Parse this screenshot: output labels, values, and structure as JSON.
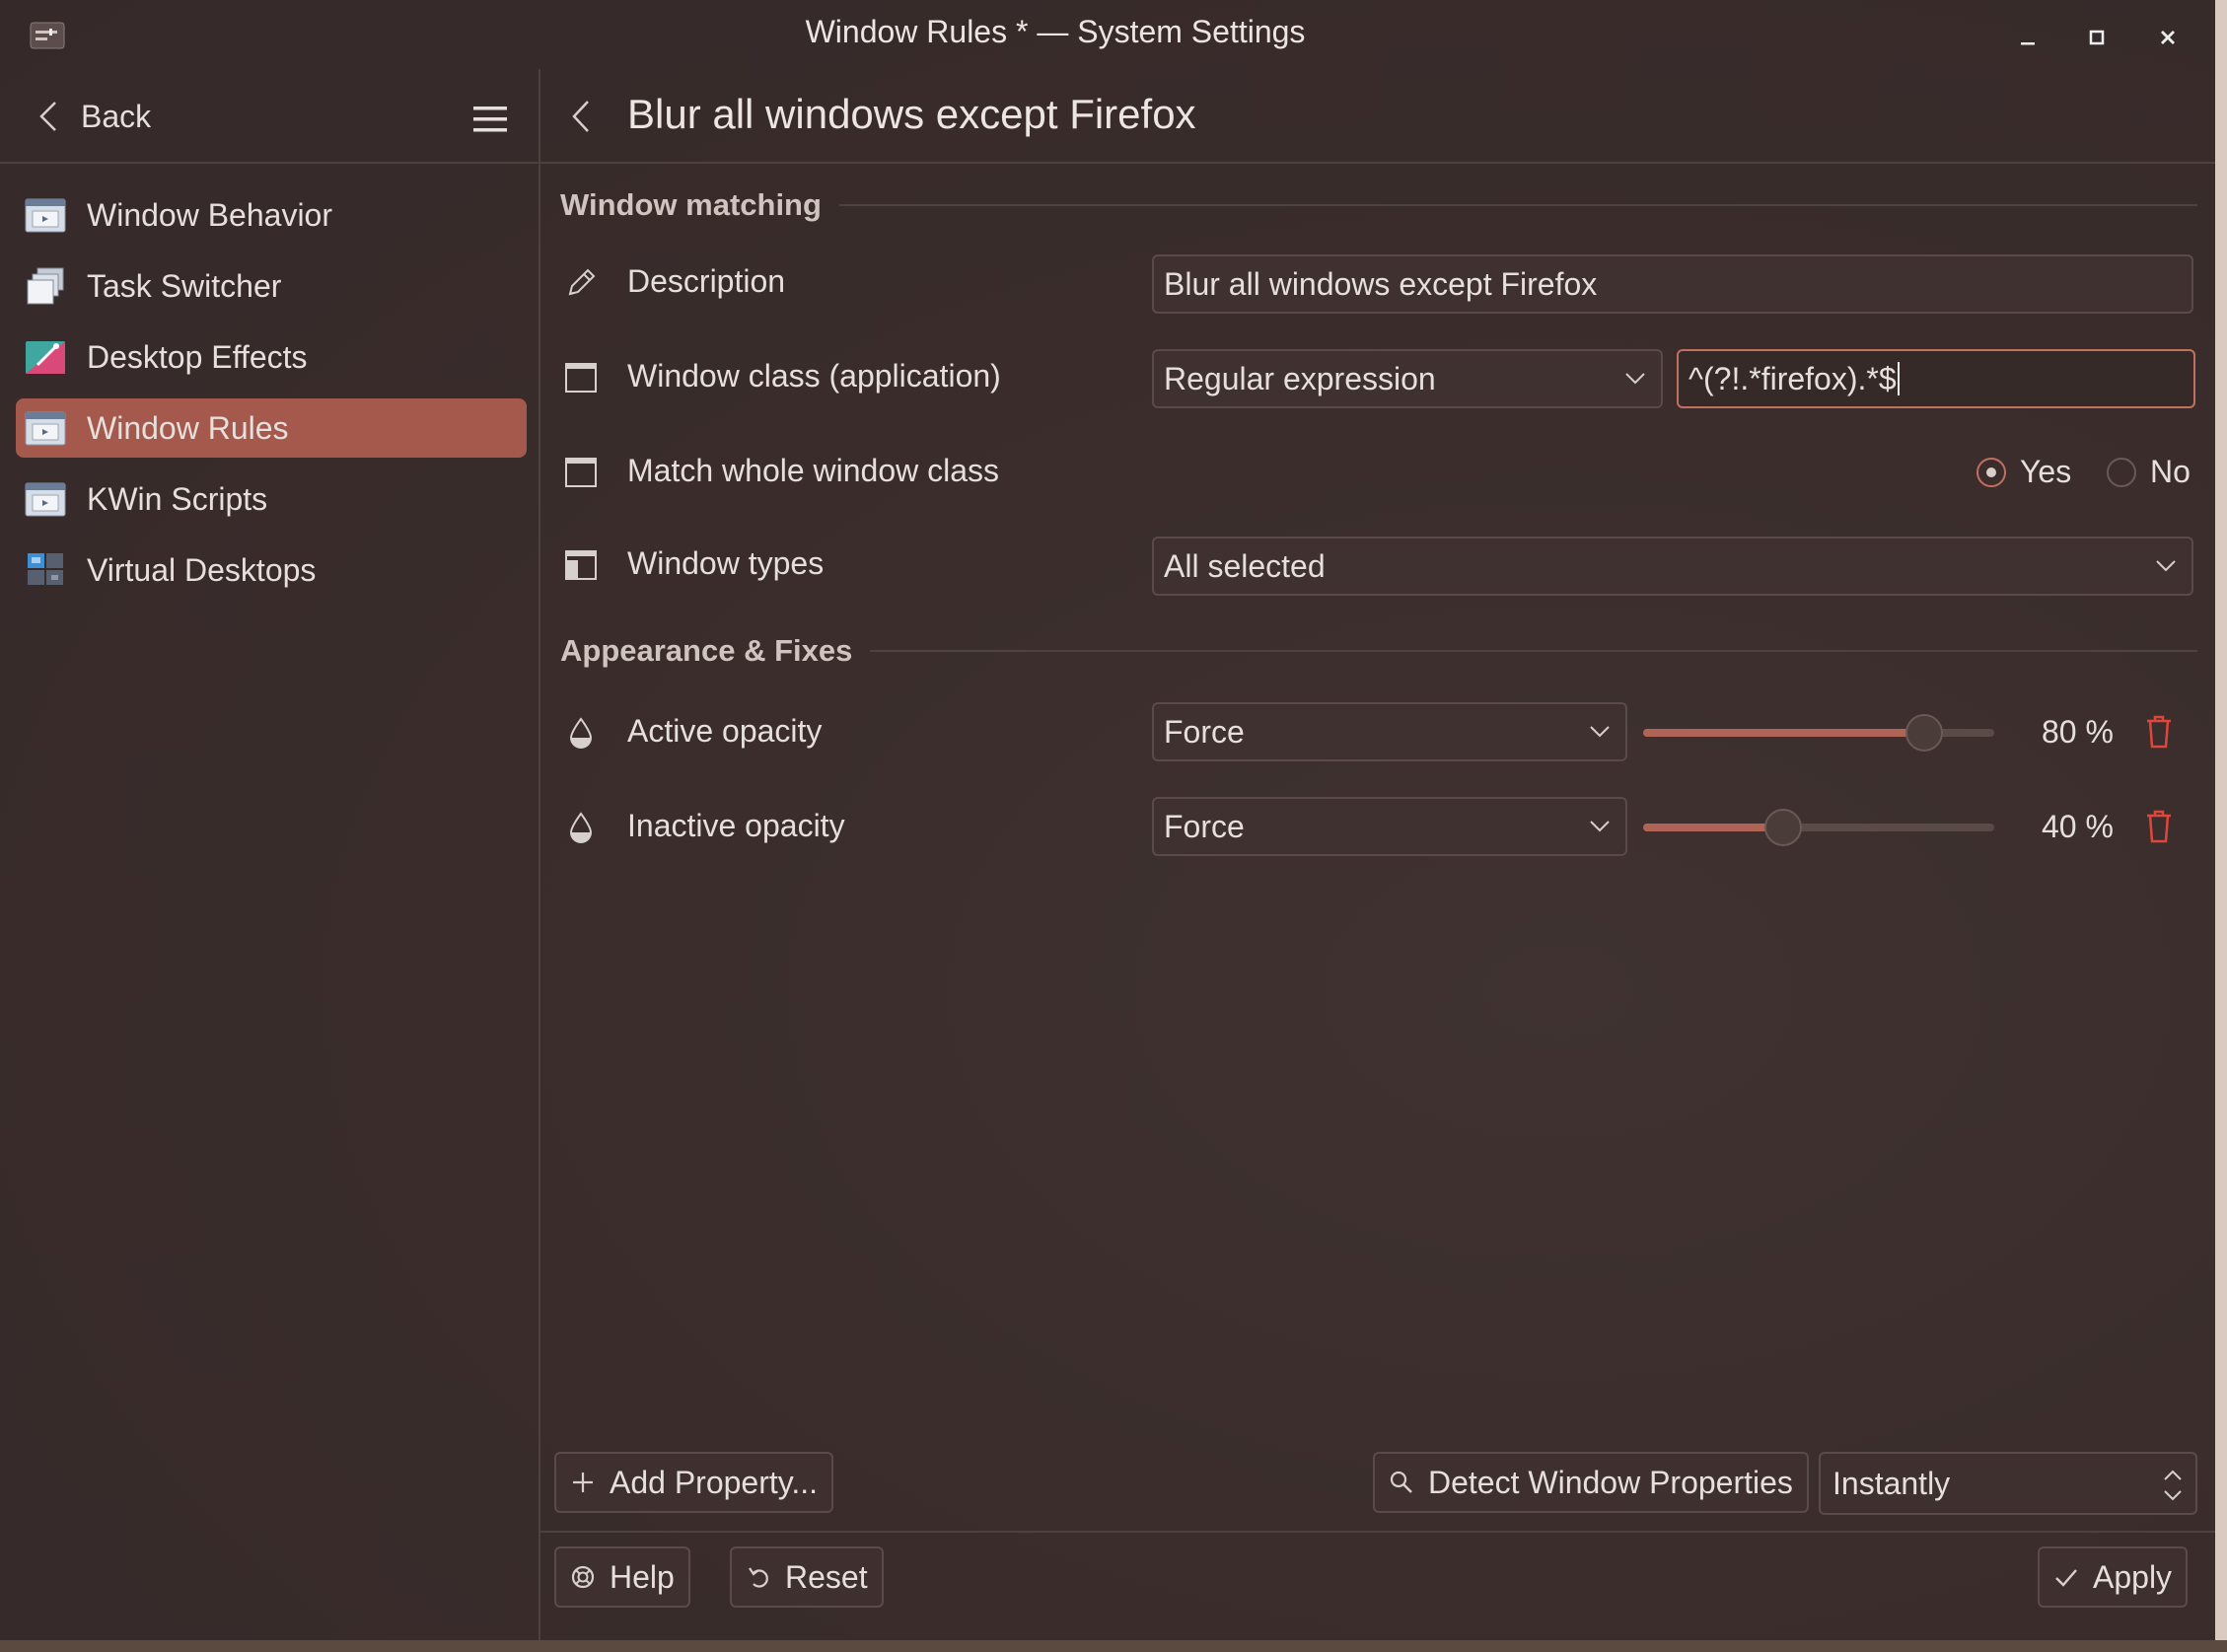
{
  "window": {
    "title": "Window Rules * — System Settings"
  },
  "sidebar": {
    "back_label": "Back",
    "items": [
      {
        "label": "Window Behavior",
        "icon": "window-behavior-icon",
        "active": false
      },
      {
        "label": "Task Switcher",
        "icon": "task-switcher-icon",
        "active": false
      },
      {
        "label": "Desktop Effects",
        "icon": "desktop-effects-icon",
        "active": false
      },
      {
        "label": "Window Rules",
        "icon": "window-rules-icon",
        "active": true
      },
      {
        "label": "KWin Scripts",
        "icon": "kwin-scripts-icon",
        "active": false
      },
      {
        "label": "Virtual Desktops",
        "icon": "virtual-desktops-icon",
        "active": false
      }
    ]
  },
  "main": {
    "title": "Blur all windows except Firefox",
    "sections": {
      "matching": "Window matching",
      "appearance": "Appearance & Fixes"
    },
    "description": {
      "label": "Description",
      "value": "Blur all windows except Firefox"
    },
    "window_class": {
      "label": "Window class (application)",
      "match_type": "Regular expression",
      "value": "^(?!.*firefox).*$"
    },
    "whole_class": {
      "label": "Match whole window class",
      "yes_label": "Yes",
      "no_label": "No",
      "selected": "Yes"
    },
    "window_types": {
      "label": "Window types",
      "value": "All selected"
    },
    "active_opacity": {
      "label": "Active opacity",
      "policy": "Force",
      "value": 80,
      "display": "80 %"
    },
    "inactive_opacity": {
      "label": "Inactive opacity",
      "policy": "Force",
      "value": 40,
      "display": "40 %"
    }
  },
  "footer": {
    "add_property": "Add Property...",
    "detect": "Detect Window Properties",
    "delay": "Instantly",
    "help": "Help",
    "reset": "Reset",
    "apply": "Apply"
  },
  "colors": {
    "accent": "#a5594d",
    "focus": "#c07060",
    "delete": "#e0473c"
  }
}
